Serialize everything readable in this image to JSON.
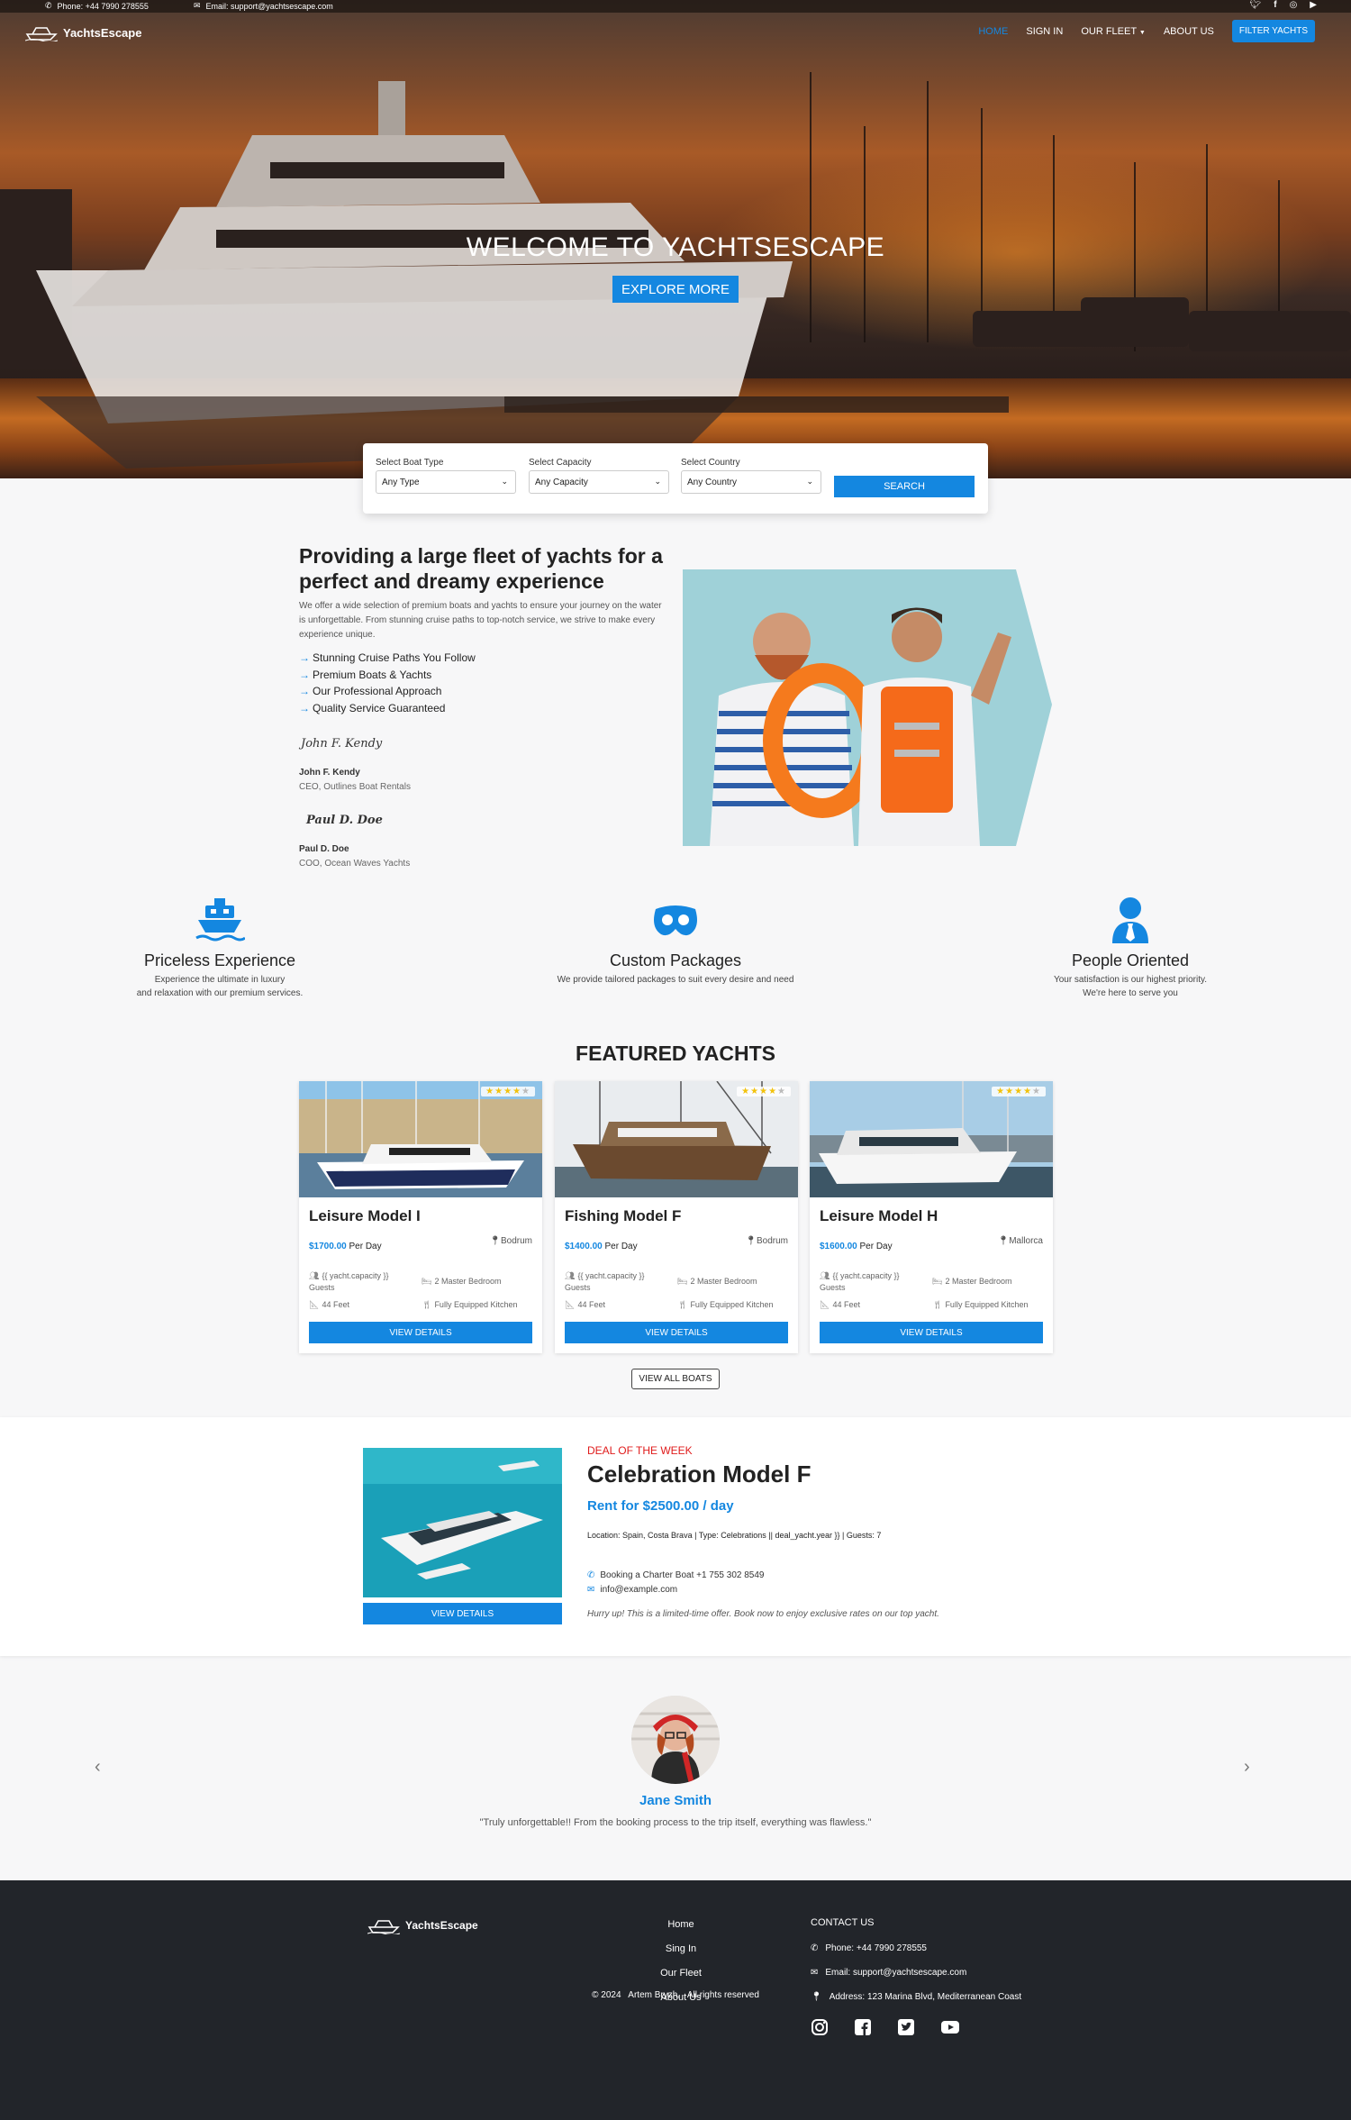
{
  "topbar": {
    "phone": "Phone: +44 7990 278555",
    "email": "Email: support@yachtsescape.com",
    "socials": [
      "twitter-icon",
      "facebook-icon",
      "instagram-icon",
      "youtube-icon"
    ]
  },
  "brand": {
    "name": "YachtsEscape"
  },
  "nav": {
    "home": "HOME",
    "signin": "SIGN IN",
    "fleet": "OUR FLEET",
    "about": "ABOUT US",
    "filter": "FILTER YACHTS"
  },
  "hero": {
    "title": "WELCOME TO YACHTSESCAPE",
    "button": "EXPLORE MORE"
  },
  "search": {
    "boat_type_label": "Select Boat Type",
    "boat_type_value": "Any Type",
    "capacity_label": "Select Capacity",
    "capacity_value": "Any Capacity",
    "country_label": "Select Country",
    "country_value": "Any Country",
    "button": "SEARCH"
  },
  "about": {
    "title": "Providing a large fleet of yachts for a perfect and dreamy experience",
    "text": "We offer a wide selection of premium boats and yachts to ensure your journey on the water is unforgettable. From stunning cruise paths to top-notch service, we strive to make every experience unique.",
    "bullets": [
      "Stunning Cruise Paths You Follow",
      "Premium Boats & Yachts",
      "Our Professional Approach",
      "Quality Service Guaranteed"
    ],
    "people": [
      {
        "signature": "John F. Kendy",
        "name": "John F. Kendy",
        "role": "CEO, Outlines Boat Rentals"
      },
      {
        "signature": "Paul D. Doe",
        "name": "Paul D. Doe",
        "role": "COO, Ocean Waves Yachts"
      }
    ]
  },
  "features": [
    {
      "icon": "ship-icon",
      "title": "Priceless Experience",
      "line1": "Experience the ultimate in luxury",
      "line2": "and relaxation with our premium services."
    },
    {
      "icon": "mask-icon",
      "title": "Custom Packages",
      "line1": "We provide tailored packages to suit every desire and need",
      "line2": ""
    },
    {
      "icon": "person-icon",
      "title": "People Oriented",
      "line1": "Your satisfaction is our highest priority.",
      "line2": "We're here to serve you"
    }
  ],
  "featured": {
    "title": "FEATURED YACHTS",
    "view_all": "VIEW ALL BOATS",
    "cards": [
      {
        "name": "Leisure Model I",
        "price": "$1700.00",
        "per": "Per Day",
        "location": "Bodrum",
        "rating": 4,
        "guests": "{{ yacht.capacity }} Guests",
        "bedroom": "2 Master Bedroom",
        "length": "44 Feet",
        "kitchen": "Fully Equipped Kitchen",
        "button": "VIEW DETAILS"
      },
      {
        "name": "Fishing Model F",
        "price": "$1400.00",
        "per": "Per Day",
        "location": "Bodrum",
        "rating": 4,
        "guests": "{{ yacht.capacity }} Guests",
        "bedroom": "2 Master Bedroom",
        "length": "44 Feet",
        "kitchen": "Fully Equipped Kitchen",
        "button": "VIEW DETAILS"
      },
      {
        "name": "Leisure Model H",
        "price": "$1600.00",
        "per": "Per Day",
        "location": "Mallorca",
        "rating": 4,
        "guests": "{{ yacht.capacity }} Guests",
        "bedroom": "2 Master Bedroom",
        "length": "44 Feet",
        "kitchen": "Fully Equipped Kitchen",
        "button": "VIEW DETAILS"
      }
    ]
  },
  "deal": {
    "label": "DEAL OF THE WEEK",
    "title": "Celebration Model F",
    "rent": "Rent for $2500.00 / day",
    "meta": "Location: Spain, Costa Brava | Type: Celebrations || deal_yacht.year }} | Guests: 7",
    "phone": "Booking a Charter Boat +1 755 302 8549",
    "email": "info@example.com",
    "note": "Hurry up! This is a limited-time offer. Book now to enjoy exclusive rates on our top yacht.",
    "button": "VIEW DETAILS"
  },
  "testimonial": {
    "name": "Jane Smith",
    "quote": "\"Truly unforgettable!! From the booking process to the trip itself, everything was flawless.\""
  },
  "footer": {
    "links": [
      "Home",
      "Sing In",
      "Our Fleet",
      "About Us"
    ],
    "contact_title": "CONTACT US",
    "phone": "Phone: +44 7990 278555",
    "email": "Email: support@yachtsescape.com",
    "address": "Address: 123 Marina Blvd, Mediterranean Coast",
    "socials": [
      "instagram-icon",
      "facebook-square-icon",
      "twitter-square-icon",
      "youtube-icon"
    ],
    "copyright": "© 2024   Artem Bryzh.   All rights reserved"
  },
  "colors": {
    "accent": "#1487e0",
    "deal_red": "#e01b1b",
    "footer_bg": "#22252a"
  }
}
